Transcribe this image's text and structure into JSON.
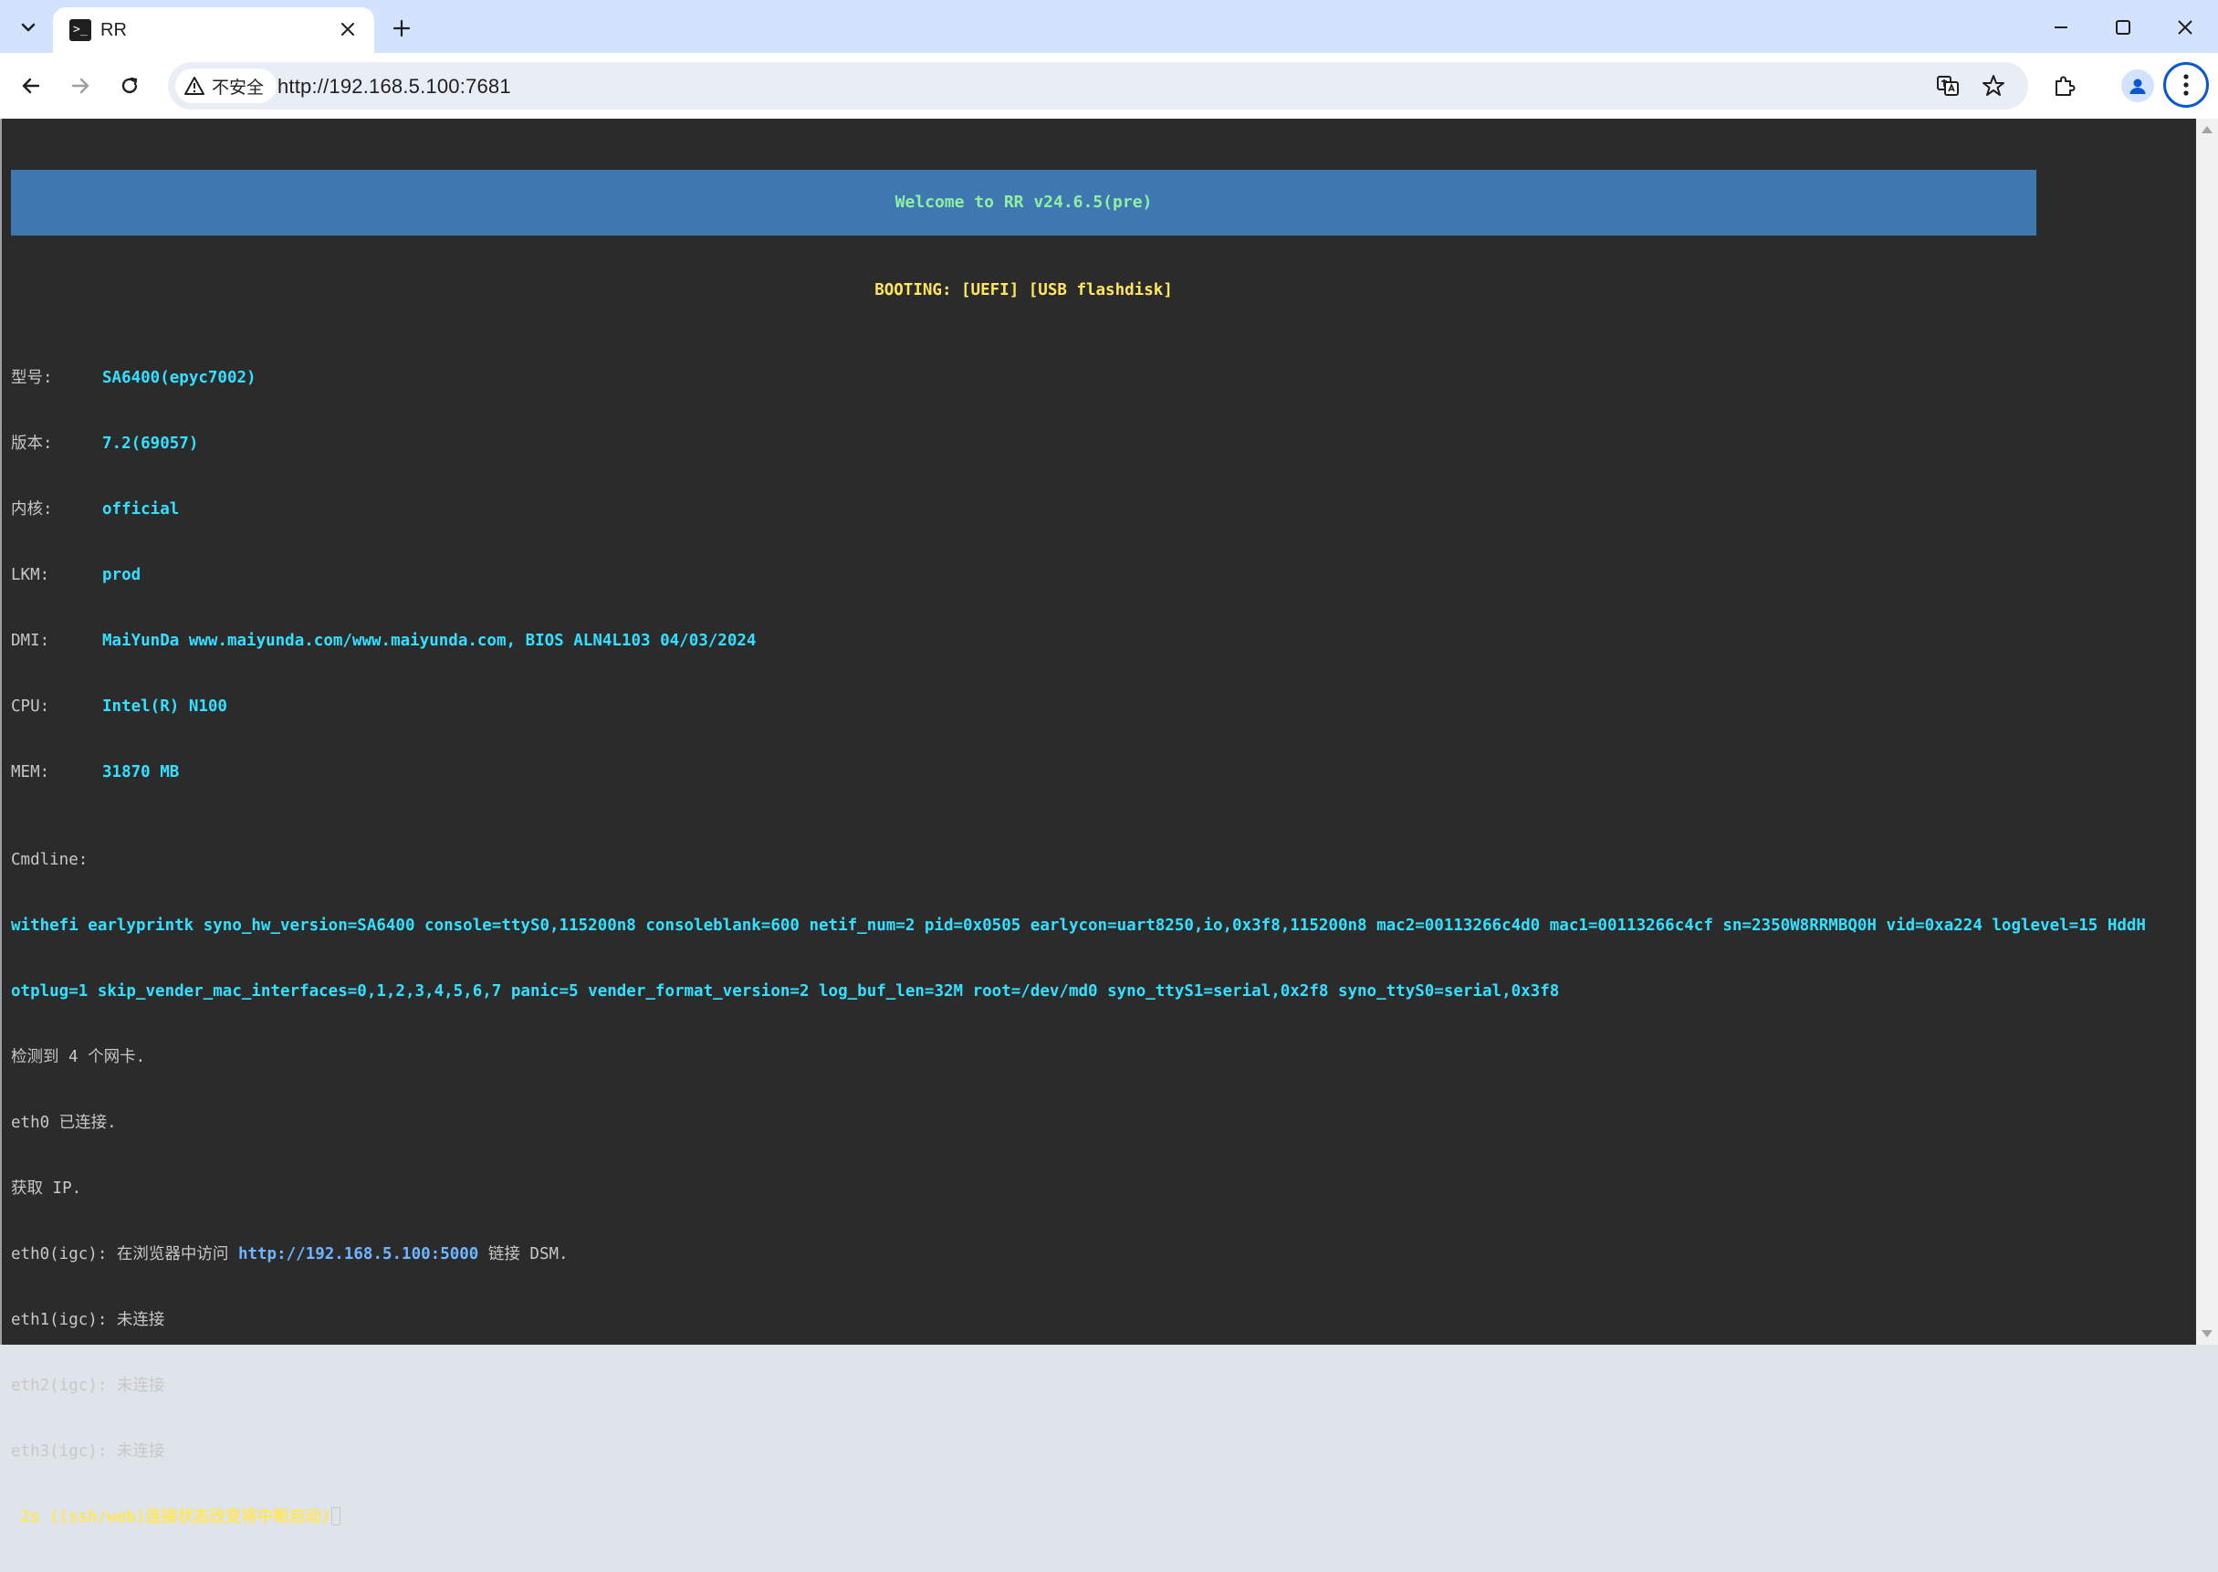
{
  "tab": {
    "title": "RR"
  },
  "address_bar": {
    "security_label": "不安全",
    "url": "http://192.168.5.100:7681"
  },
  "terminal": {
    "banner": "Welcome to RR v24.6.5(pre)",
    "boot_line": "BOOTING: [UEFI] [USB flashdisk]",
    "info": [
      {
        "label": "型号:",
        "value": "SA6400(epyc7002)"
      },
      {
        "label": "版本:",
        "value": "7.2(69057)"
      },
      {
        "label": "内核:",
        "value": "official"
      },
      {
        "label": "LKM:",
        "value": "prod"
      },
      {
        "label": "DMI:",
        "value": "MaiYunDa www.maiyunda.com/www.maiyunda.com, BIOS ALN4L103 04/03/2024"
      },
      {
        "label": "CPU:",
        "value": "Intel(R) N100"
      },
      {
        "label": "MEM:",
        "value": "31870 MB"
      }
    ],
    "cmdline_label": "Cmdline:",
    "cmdline_1": "withefi earlyprintk syno_hw_version=SA6400 console=ttyS0,115200n8 consoleblank=600 netif_num=2 pid=0x0505 earlycon=uart8250,io,0x3f8,115200n8 mac2=00113266c4d0 mac1=00113266c4cf sn=2350W8RRMBQ0H vid=0xa224 loglevel=15 HddH",
    "cmdline_2": "otplug=1 skip_vender_mac_interfaces=0,1,2,3,4,5,6,7 panic=5 vender_format_version=2 log_buf_len=32M root=/dev/md0 syno_ttyS1=serial,0x2f8 syno_ttyS0=serial,0x3f8",
    "nic_detected": "检测到 4 个网卡.",
    "eth0_connected": "eth0 已连接.",
    "get_ip": "获取 IP.",
    "eth0_prefix": "eth0(igc): 在浏览器中访问 ",
    "eth0_url": "http://192.168.5.100:5000",
    "eth0_suffix": " 链接 DSM.",
    "eth1": "eth1(igc): 未连接",
    "eth2": "eth2(igc): 未连接",
    "eth3": "eth3(igc): 未连接",
    "countdown": " 2s ((ssh/web)连接状态改变将中断启动)"
  }
}
